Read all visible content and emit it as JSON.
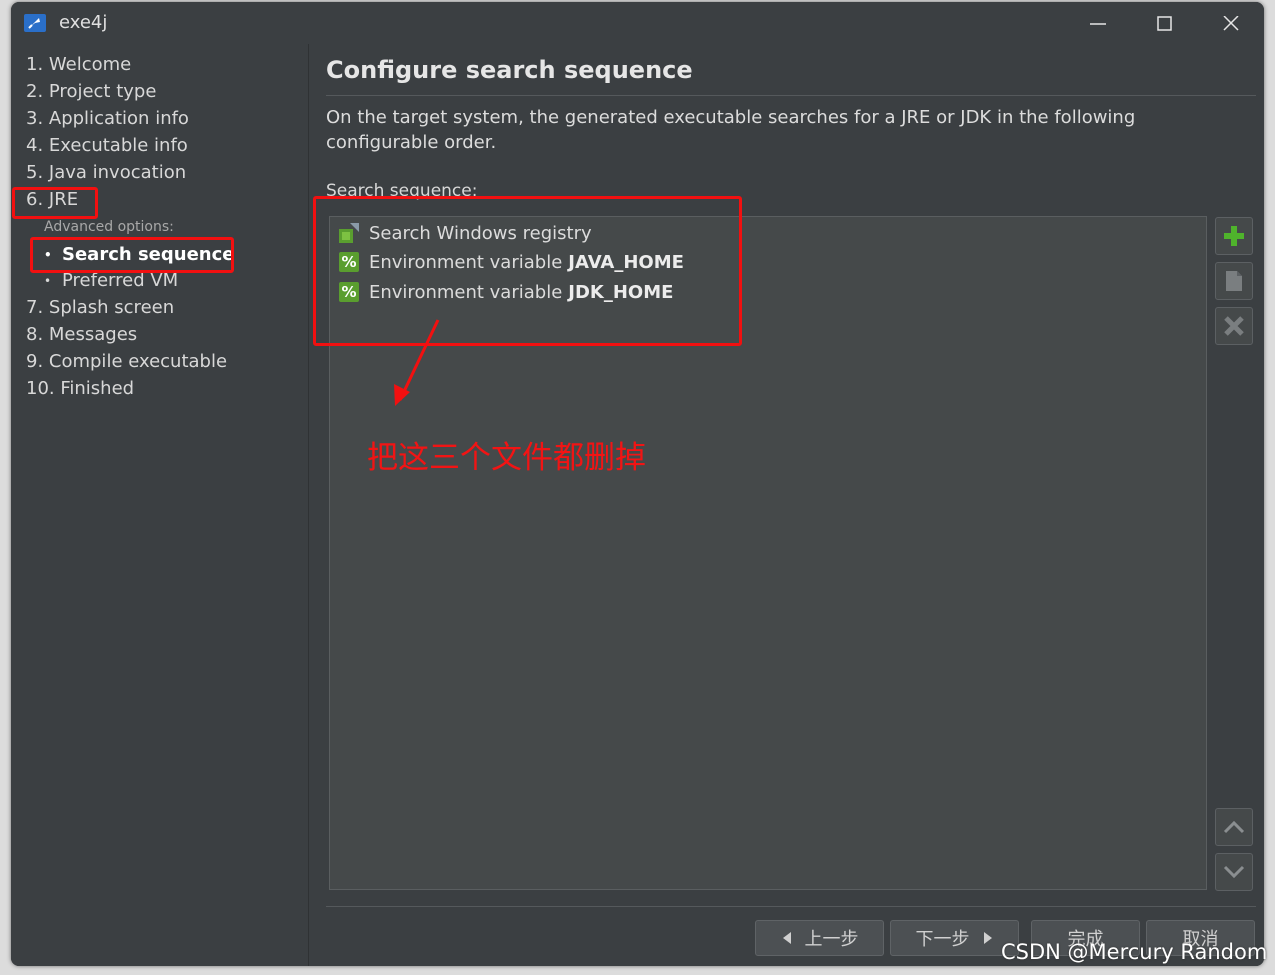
{
  "window": {
    "title": "exe4j"
  },
  "sidebar": {
    "steps": [
      "1. Welcome",
      "2. Project type",
      "3. Application info",
      "4. Executable info",
      "5. Java invocation",
      "6. JRE",
      "7. Splash screen",
      "8. Messages",
      "9. Compile executable",
      "10. Finished"
    ],
    "advanced_label": "Advanced options:",
    "sub_items": [
      "Search sequence",
      "Preferred VM"
    ],
    "sub_bullet": "•"
  },
  "main": {
    "title": "Configure search sequence",
    "description": "On the target system, the generated executable searches for a JRE or JDK in the following configurable order.",
    "sequence_label": "Search sequence:",
    "items": [
      {
        "text": "Search Windows registry",
        "bold": "",
        "icon": "registry-icon"
      },
      {
        "text": "Environment variable",
        "bold": "JAVA_HOME",
        "icon": "percent-icon"
      },
      {
        "text": "Environment variable",
        "bold": "JDK_HOME",
        "icon": "percent-icon"
      }
    ],
    "percent_glyph": "%"
  },
  "buttons": {
    "back": "上一步",
    "next": "下一步",
    "finish": "完成",
    "cancel": "取消"
  },
  "annotation": {
    "text": "把这三个文件都删掉",
    "color": "#f21414"
  },
  "watermark": "CSDN @Mercury Random",
  "colors": {
    "background": "#3b3f42",
    "list_bg": "#45494a",
    "accent_green": "#5a9e2f",
    "highlight_red": "#f21010"
  }
}
